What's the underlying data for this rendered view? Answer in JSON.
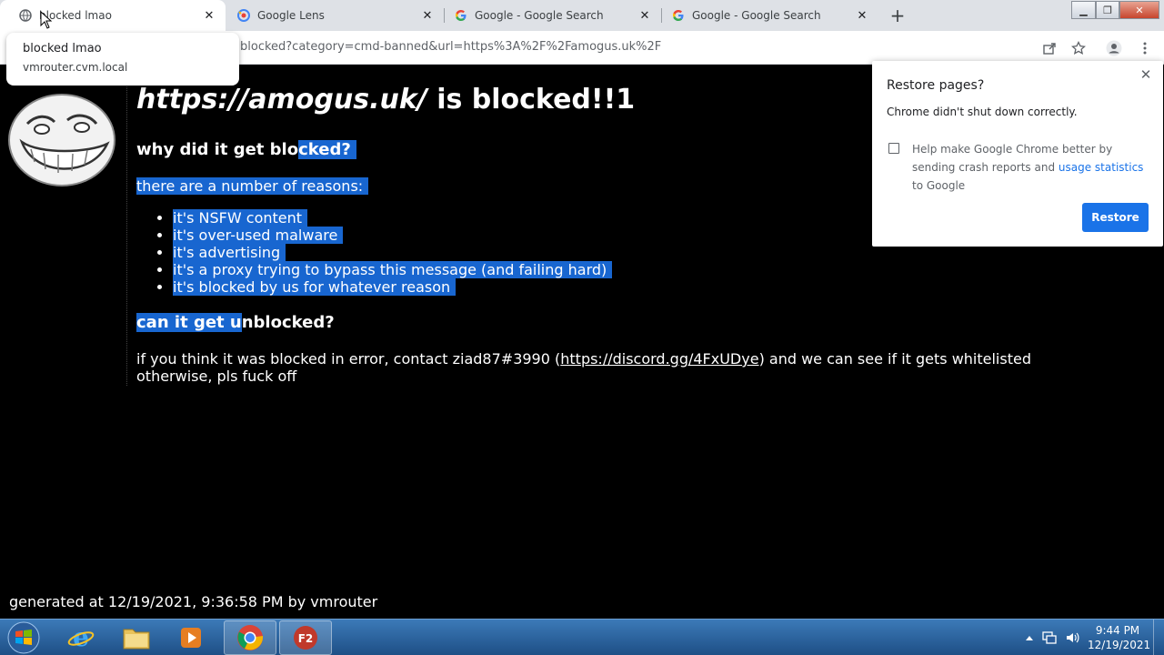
{
  "browser": {
    "tabs": [
      {
        "title": "blocked lmao",
        "icon": "globe-icon",
        "active": true
      },
      {
        "title": "Google Lens",
        "icon": "google-lens-icon",
        "active": false
      },
      {
        "title": "Google - Google Search",
        "icon": "google-icon",
        "active": false
      },
      {
        "title": "Google - Google Search",
        "icon": "google-icon",
        "active": false
      }
    ],
    "new_tab_label": "+",
    "close_glyph": "✕",
    "url_visible": "blocked?category=cmd-banned&url=https%3A%2F%2Famogus.uk%2F",
    "window_controls": {
      "minimize": "▁",
      "restore": "❐",
      "close": "✕"
    }
  },
  "tooltip": {
    "title": "blocked lmao",
    "url": "vmrouter.cvm.local"
  },
  "page": {
    "heading_url": "https://amogus.uk/",
    "heading_rest": " is blocked!!1",
    "why_part1": "why did it get blo",
    "why_part2": "cked?",
    "reasons_intro": "there are a number of reasons:",
    "reasons": [
      "it's NSFW content",
      "it's over-used malware",
      "it's advertising",
      "it's a proxy trying to bypass this message (and failing hard)",
      "it's blocked by us for whatever reason"
    ],
    "unblock_part1": "can it get u",
    "unblock_part2": "nblocked?",
    "contact_pre": "if you think it was blocked in error, contact ziad87#3990 (",
    "contact_link": "https://discord.gg/4FxUDye",
    "contact_post": ") and we can see if it gets whitelisted",
    "contact_line2": "otherwise, pls fuck off",
    "footer": "generated at 12/19/2021, 9:36:58 PM by vmrouter",
    "troll_icon": "trollface-image"
  },
  "restore_popup": {
    "title": "Restore pages?",
    "message": "Chrome didn't shut down correctly.",
    "help_pre": "Help make Google Chrome better by sending crash reports and ",
    "help_link": "usage statistics",
    "help_post": " to Google",
    "button": "Restore",
    "close_glyph": "✕"
  },
  "taskbar": {
    "apps": [
      "internet-explorer-icon",
      "file-explorer-icon",
      "media-player-icon",
      "chrome-icon",
      "f2-app-icon"
    ],
    "clock_time": "9:44 PM",
    "clock_date": "12/19/2021"
  },
  "colors": {
    "selection": "#1866d0",
    "chrome_blue": "#1a73e8",
    "page_bg": "#000000"
  }
}
